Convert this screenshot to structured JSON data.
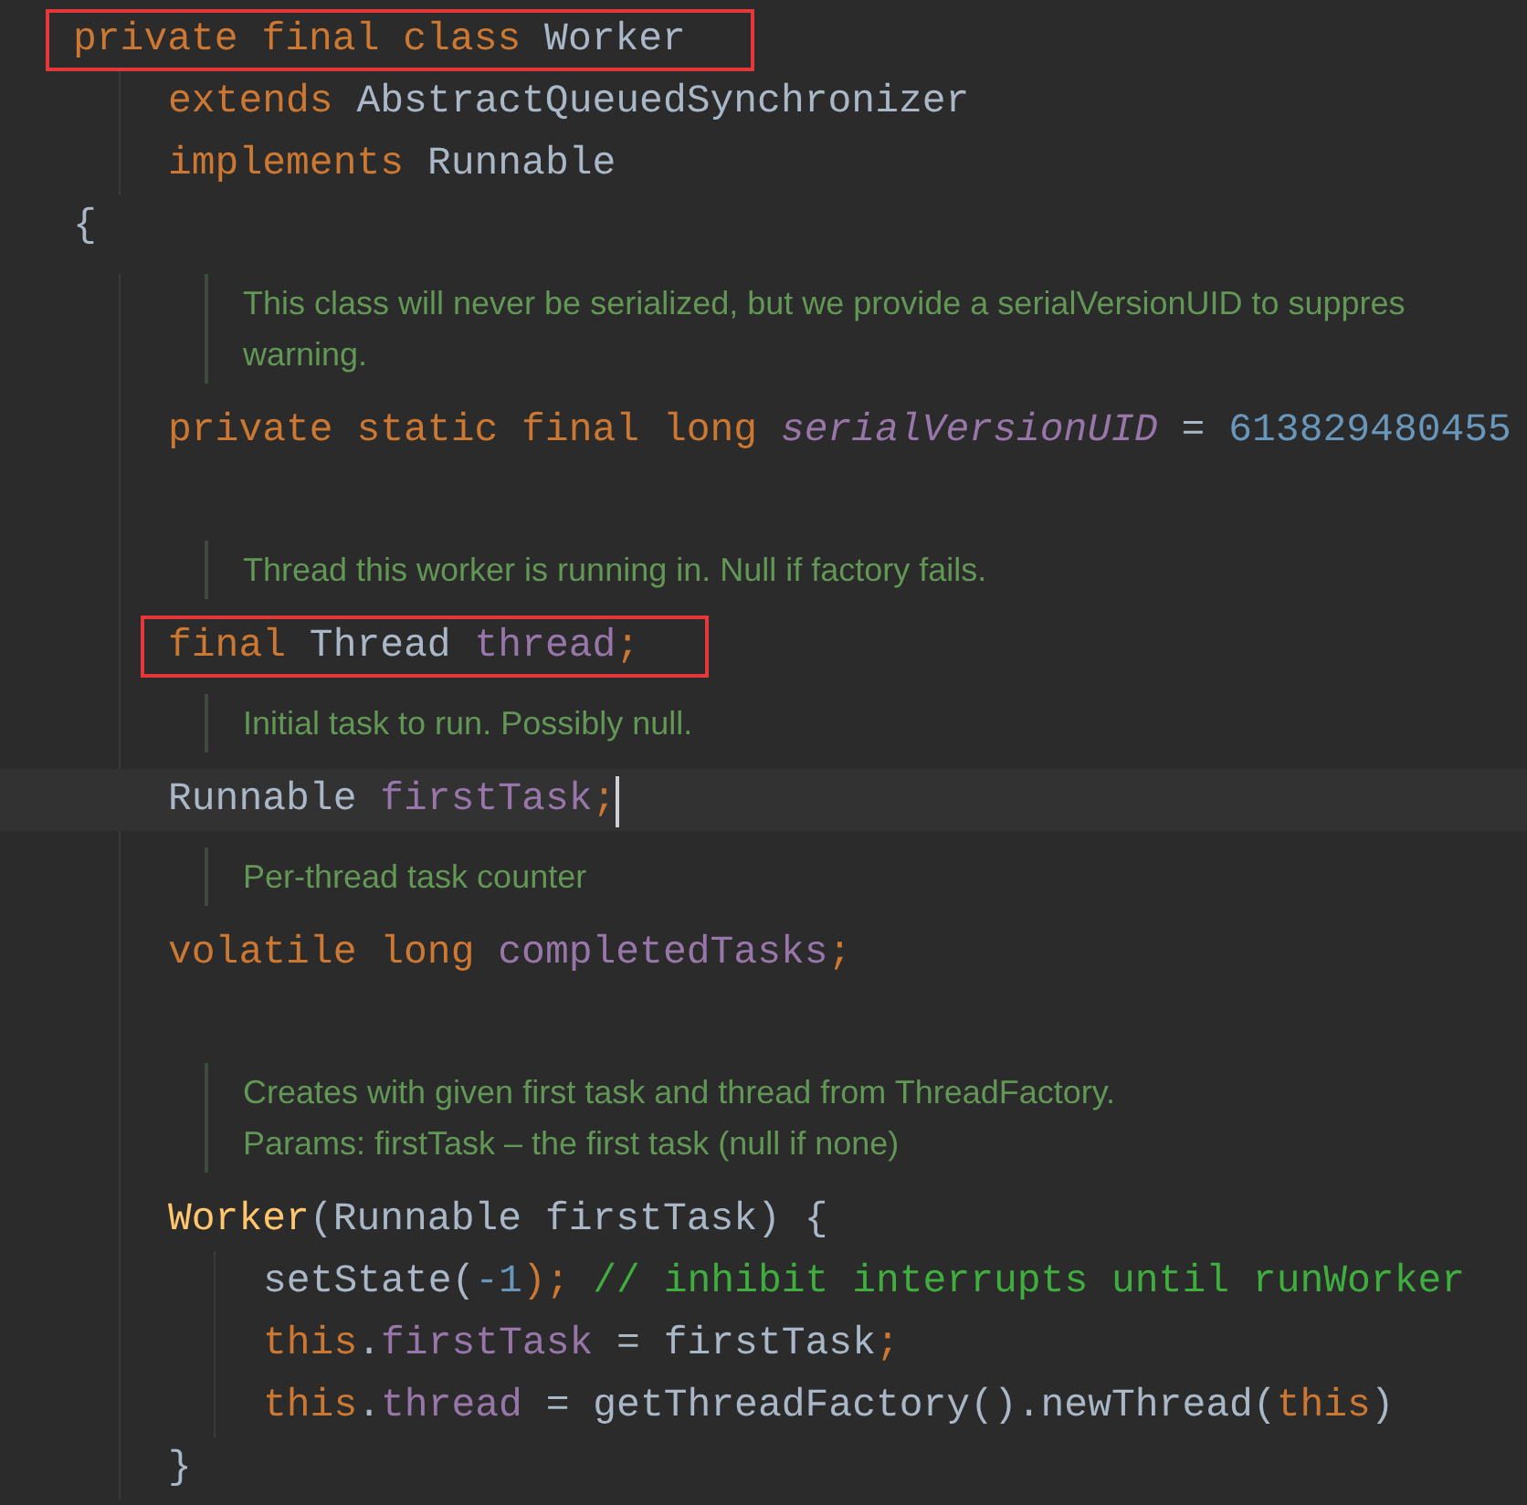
{
  "editor": {
    "items": [
      {
        "kind": "code",
        "boxed": true,
        "current": false,
        "tokens": [
          {
            "text": "private final class ",
            "kind": "keyword"
          },
          {
            "text": "Worker",
            "kind": "plain"
          }
        ]
      },
      {
        "kind": "block",
        "children": [
          {
            "kind": "code",
            "boxed": false,
            "current": false,
            "tokens": [
              {
                "text": "extends ",
                "kind": "keyword"
              },
              {
                "text": "AbstractQueuedSynchronizer",
                "kind": "plain"
              }
            ]
          },
          {
            "kind": "code",
            "boxed": false,
            "current": false,
            "tokens": [
              {
                "text": "implements ",
                "kind": "keyword"
              },
              {
                "text": "Runnable",
                "kind": "plain"
              }
            ]
          }
        ]
      },
      {
        "kind": "code",
        "boxed": false,
        "current": false,
        "tokens": [
          {
            "text": "{",
            "kind": "plain"
          }
        ]
      },
      {
        "kind": "block",
        "children": [
          {
            "kind": "doc",
            "lines": [
              "This class will never be serialized, but we provide a serialVersionUID to suppres",
              "warning."
            ]
          },
          {
            "kind": "code",
            "boxed": false,
            "current": false,
            "tokens": [
              {
                "text": "private static final long ",
                "kind": "keyword"
              },
              {
                "text": "serialVersionUID",
                "kind": "static"
              },
              {
                "text": " = ",
                "kind": "plain"
              },
              {
                "text": "613829480455",
                "kind": "number"
              }
            ]
          },
          {
            "kind": "blank"
          },
          {
            "kind": "doc",
            "lines": [
              "Thread this worker is running in. Null if factory fails."
            ]
          },
          {
            "kind": "code",
            "boxed": true,
            "current": false,
            "tokens": [
              {
                "text": "final ",
                "kind": "keyword"
              },
              {
                "text": "Thread ",
                "kind": "plain"
              },
              {
                "text": "thread",
                "kind": "field"
              },
              {
                "text": ";",
                "kind": "keyword"
              }
            ]
          },
          {
            "kind": "doc",
            "lines": [
              "Initial task to run. Possibly null."
            ]
          },
          {
            "kind": "code",
            "boxed": false,
            "current": true,
            "tokens": [
              {
                "text": "Runnable ",
                "kind": "plain"
              },
              {
                "text": "firstTask",
                "kind": "field"
              },
              {
                "text": ";",
                "kind": "keyword"
              }
            ]
          },
          {
            "kind": "doc",
            "lines": [
              "Per-thread task counter"
            ]
          },
          {
            "kind": "code",
            "boxed": false,
            "current": false,
            "tokens": [
              {
                "text": "volatile long ",
                "kind": "keyword"
              },
              {
                "text": "completedTasks",
                "kind": "field"
              },
              {
                "text": ";",
                "kind": "keyword"
              }
            ]
          },
          {
            "kind": "blank"
          },
          {
            "kind": "doc",
            "lines": [
              "Creates with given first task and thread from ThreadFactory.",
              "Params: firstTask – the first task (null if none)"
            ]
          },
          {
            "kind": "code",
            "boxed": false,
            "current": false,
            "tokens": [
              {
                "text": "Worker",
                "kind": "method"
              },
              {
                "text": "(Runnable firstTask) {",
                "kind": "plain"
              }
            ]
          },
          {
            "kind": "block",
            "children": [
              {
                "kind": "code",
                "boxed": false,
                "current": false,
                "tokens": [
                  {
                    "text": "setState(",
                    "kind": "plain"
                  },
                  {
                    "text": "-1",
                    "kind": "number"
                  },
                  {
                    "text": "); ",
                    "kind": "keyword"
                  },
                  {
                    "text": "// inhibit interrupts until runWorker",
                    "kind": "comment"
                  }
                ]
              },
              {
                "kind": "code",
                "boxed": false,
                "current": false,
                "tokens": [
                  {
                    "text": "this",
                    "kind": "keyword"
                  },
                  {
                    "text": ".",
                    "kind": "plain"
                  },
                  {
                    "text": "firstTask",
                    "kind": "field"
                  },
                  {
                    "text": " = firstTask",
                    "kind": "plain"
                  },
                  {
                    "text": ";",
                    "kind": "keyword"
                  }
                ]
              },
              {
                "kind": "code",
                "boxed": false,
                "current": false,
                "tokens": [
                  {
                    "text": "this",
                    "kind": "keyword"
                  },
                  {
                    "text": ".",
                    "kind": "plain"
                  },
                  {
                    "text": "thread",
                    "kind": "field"
                  },
                  {
                    "text": " = getThreadFactory().newThread(",
                    "kind": "plain"
                  },
                  {
                    "text": "this",
                    "kind": "keyword"
                  },
                  {
                    "text": ")",
                    "kind": "plain"
                  }
                ]
              }
            ]
          },
          {
            "kind": "code",
            "boxed": false,
            "current": false,
            "tokens": [
              {
                "text": "}",
                "kind": "plain"
              }
            ]
          }
        ]
      }
    ]
  }
}
